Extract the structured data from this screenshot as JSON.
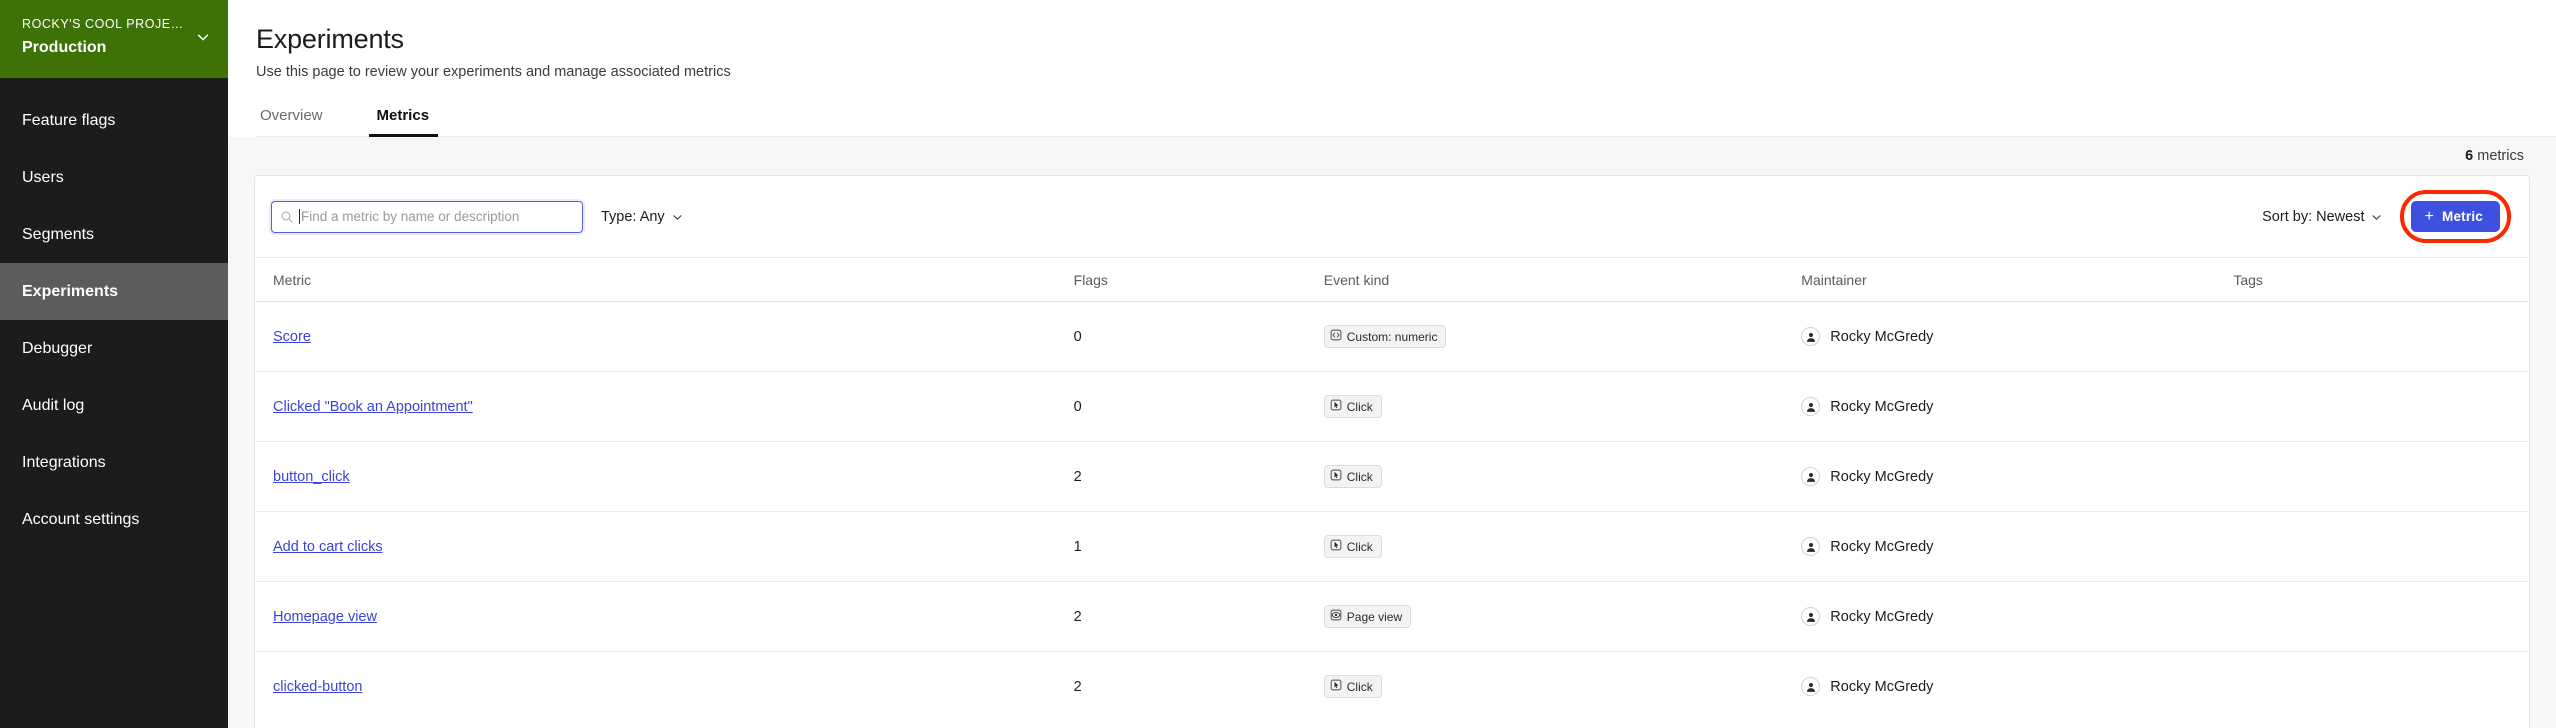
{
  "sidebar": {
    "project": {
      "name": "ROCKY'S COOL PROJE…",
      "environment": "Production",
      "chevron_icon": "chevron-down-icon"
    },
    "items": [
      {
        "label": "Feature flags",
        "active": false
      },
      {
        "label": "Users",
        "active": false
      },
      {
        "label": "Segments",
        "active": false
      },
      {
        "label": "Experiments",
        "active": true
      },
      {
        "label": "Debugger",
        "active": false
      },
      {
        "label": "Audit log",
        "active": false
      },
      {
        "label": "Integrations",
        "active": false
      },
      {
        "label": "Account settings",
        "active": false
      }
    ]
  },
  "header": {
    "title": "Experiments",
    "subtitle": "Use this page to review your experiments and manage associated metrics"
  },
  "tabs": [
    {
      "label": "Overview",
      "active": false
    },
    {
      "label": "Metrics",
      "active": true
    }
  ],
  "count": {
    "number": "6",
    "unit": "metrics"
  },
  "toolbar": {
    "search": {
      "placeholder": "Find a metric by name or description",
      "value": "",
      "icon": "search-icon"
    },
    "type_filter": {
      "label": "Type: Any",
      "icon": "chevron-down-icon"
    },
    "sort_by": {
      "label": "Sort by: Newest",
      "icon": "chevron-down-icon"
    },
    "add_metric": {
      "label": "Metric",
      "plus": "+",
      "icon": "plus-icon"
    }
  },
  "colors": {
    "sidebar_bg": "#1c1c1c",
    "project_green": "#3d7206",
    "active_nav": "#5c5c5c",
    "primary_button": "#3d50e0",
    "focus_border": "#5561e8",
    "link": "#3b44d6",
    "annotation_ring": "#fa2a00"
  },
  "table": {
    "columns": [
      "Metric",
      "Flags",
      "Event kind",
      "Maintainer",
      "Tags"
    ],
    "rows": [
      {
        "metric": "Score",
        "flags": "0",
        "kind": "Custom: numeric",
        "kind_icon": "code-icon",
        "maintainer": "Rocky McGredy",
        "tags": ""
      },
      {
        "metric": "Clicked \"Book an Appointment\"",
        "flags": "0",
        "kind": "Click",
        "kind_icon": "cursor-icon",
        "maintainer": "Rocky McGredy",
        "tags": ""
      },
      {
        "metric": "button_click",
        "flags": "2",
        "kind": "Click",
        "kind_icon": "cursor-icon",
        "maintainer": "Rocky McGredy",
        "tags": ""
      },
      {
        "metric": "Add to cart clicks",
        "flags": "1",
        "kind": "Click",
        "kind_icon": "cursor-icon",
        "maintainer": "Rocky McGredy",
        "tags": ""
      },
      {
        "metric": "Homepage view",
        "flags": "2",
        "kind": "Page view",
        "kind_icon": "page-view-icon",
        "maintainer": "Rocky McGredy",
        "tags": ""
      },
      {
        "metric": "clicked-button",
        "flags": "2",
        "kind": "Click",
        "kind_icon": "cursor-icon",
        "maintainer": "Rocky McGredy",
        "tags": ""
      }
    ]
  }
}
